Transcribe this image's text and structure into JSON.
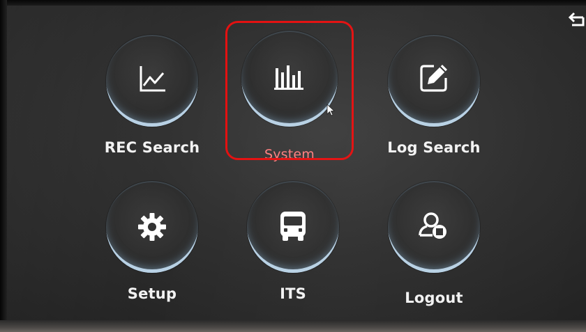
{
  "header": {
    "back_icon": "back-return-icon"
  },
  "menu": {
    "items": [
      {
        "label": "REC Search",
        "icon": "line-chart-icon"
      },
      {
        "label": "System",
        "icon": "bar-chart-icon",
        "selected": true
      },
      {
        "label": "Log Search",
        "icon": "edit-pencil-icon"
      },
      {
        "label": "Setup",
        "icon": "gear-icon"
      },
      {
        "label": "ITS",
        "icon": "bus-icon"
      },
      {
        "label": "Logout",
        "icon": "user-logout-icon"
      }
    ]
  },
  "colors": {
    "selected_outline": "#e41010",
    "selected_label": "#ff7f7f",
    "label": "#f2f2f2",
    "ring_glow": "#bed7eb"
  }
}
